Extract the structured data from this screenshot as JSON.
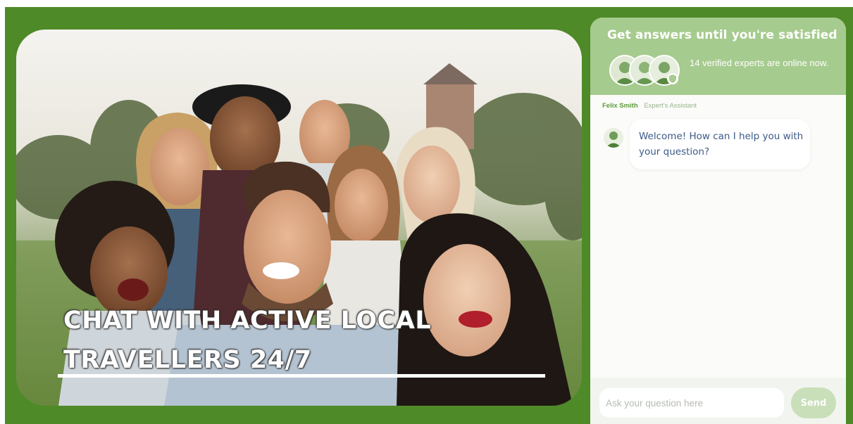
{
  "hero": {
    "headline_line1": "CHAT WITH ACTIVE LOCAL",
    "headline_line2": "TRAVELLERS 24/7",
    "image_icon": "group-selfie-photo"
  },
  "chat": {
    "title": "Get answers until you're satisfied",
    "online_text": "14 verified experts are online now.",
    "agent_name": "Felix Smith",
    "agent_role": "Expert's Assistant",
    "welcome_message": "Welcome! How can I help you with your question?",
    "input_placeholder": "Ask your question here",
    "send_label": "Send"
  },
  "colors": {
    "frame_green": "#4e8a28",
    "header_green": "#a6cb8e",
    "send_button": "#c9dfba",
    "message_text": "#3c5a86"
  }
}
